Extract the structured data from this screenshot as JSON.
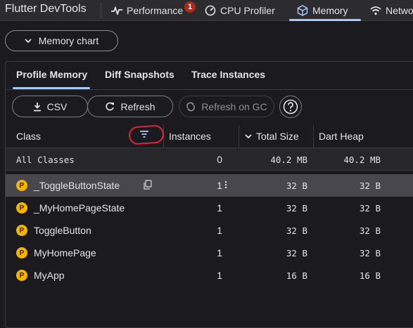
{
  "app": {
    "title": "Flutter DevTools"
  },
  "topnav": {
    "performance": "Performance",
    "performance_badge": "1",
    "cpu": "CPU Profiler",
    "memory": "Memory",
    "network": "Netwo"
  },
  "memory_chart_button": "Memory chart",
  "subtabs": {
    "profile": "Profile Memory",
    "diff": "Diff Snapshots",
    "trace": "Trace Instances"
  },
  "toolbar": {
    "csv": "CSV",
    "refresh": "Refresh",
    "refresh_gc": "Refresh on GC"
  },
  "columns": {
    "class": "Class",
    "instances": "Instances",
    "total_size": "Total Size",
    "dart_heap": "Dart Heap"
  },
  "summary": {
    "name": "All Classes",
    "instances": "0",
    "total": "40.2 MB",
    "dart": "40.2 MB"
  },
  "rows": [
    {
      "icon": "P",
      "name": "_ToggleButtonState",
      "instances": "1",
      "total": "32 B",
      "dart": "32 B"
    },
    {
      "icon": "P",
      "name": "_MyHomePageState",
      "instances": "1",
      "total": "32 B",
      "dart": "32 B"
    },
    {
      "icon": "P",
      "name": "ToggleButton",
      "instances": "1",
      "total": "32 B",
      "dart": "32 B"
    },
    {
      "icon": "P",
      "name": "MyHomePage",
      "instances": "1",
      "total": "32 B",
      "dart": "32 B"
    },
    {
      "icon": "P",
      "name": "MyApp",
      "instances": "1",
      "total": "16 B",
      "dart": "16 B"
    }
  ],
  "colors": {
    "accent": "#a8c7fa",
    "badge": "#b3261e",
    "annotation": "#e0243d",
    "package_icon": "#f5b400"
  }
}
